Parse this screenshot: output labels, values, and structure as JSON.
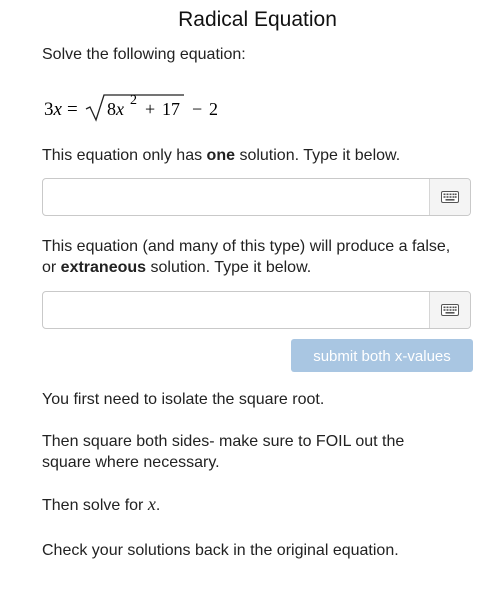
{
  "page": {
    "title": "Radical Equation",
    "instruction": "Solve the following equation:"
  },
  "equation": {
    "lhs_coef": "3",
    "lhs_var": "x",
    "equals": "=",
    "radicand_coef": "8",
    "radicand_var": "x",
    "radicand_exp": "2",
    "radicand_plus": "+",
    "radicand_const": "17",
    "minus": "−",
    "const": "2"
  },
  "part1": {
    "prompt_before": "This equation only has ",
    "prompt_bold": "one",
    "prompt_after": " solution. Type it below.",
    "value": "",
    "keyboard_icon": "keyboard-icon"
  },
  "part2": {
    "prompt_before": " This equation (and many of this type) will produce a false, or ",
    "prompt_bold": "extraneous",
    "prompt_after": " solution. Type it below.",
    "value": "",
    "keyboard_icon": "keyboard-icon"
  },
  "submit": {
    "label": "submit both x-values",
    "color": "#a9c6e2"
  },
  "hints": {
    "step1": "You first need to isolate the square root.",
    "step2": "Then square both sides- make sure to FOIL out the square where necessary.",
    "step3_before": "Then solve for ",
    "step3_var": "x",
    "step3_after": ".",
    "step4": "Check your solutions back in the original equation."
  }
}
